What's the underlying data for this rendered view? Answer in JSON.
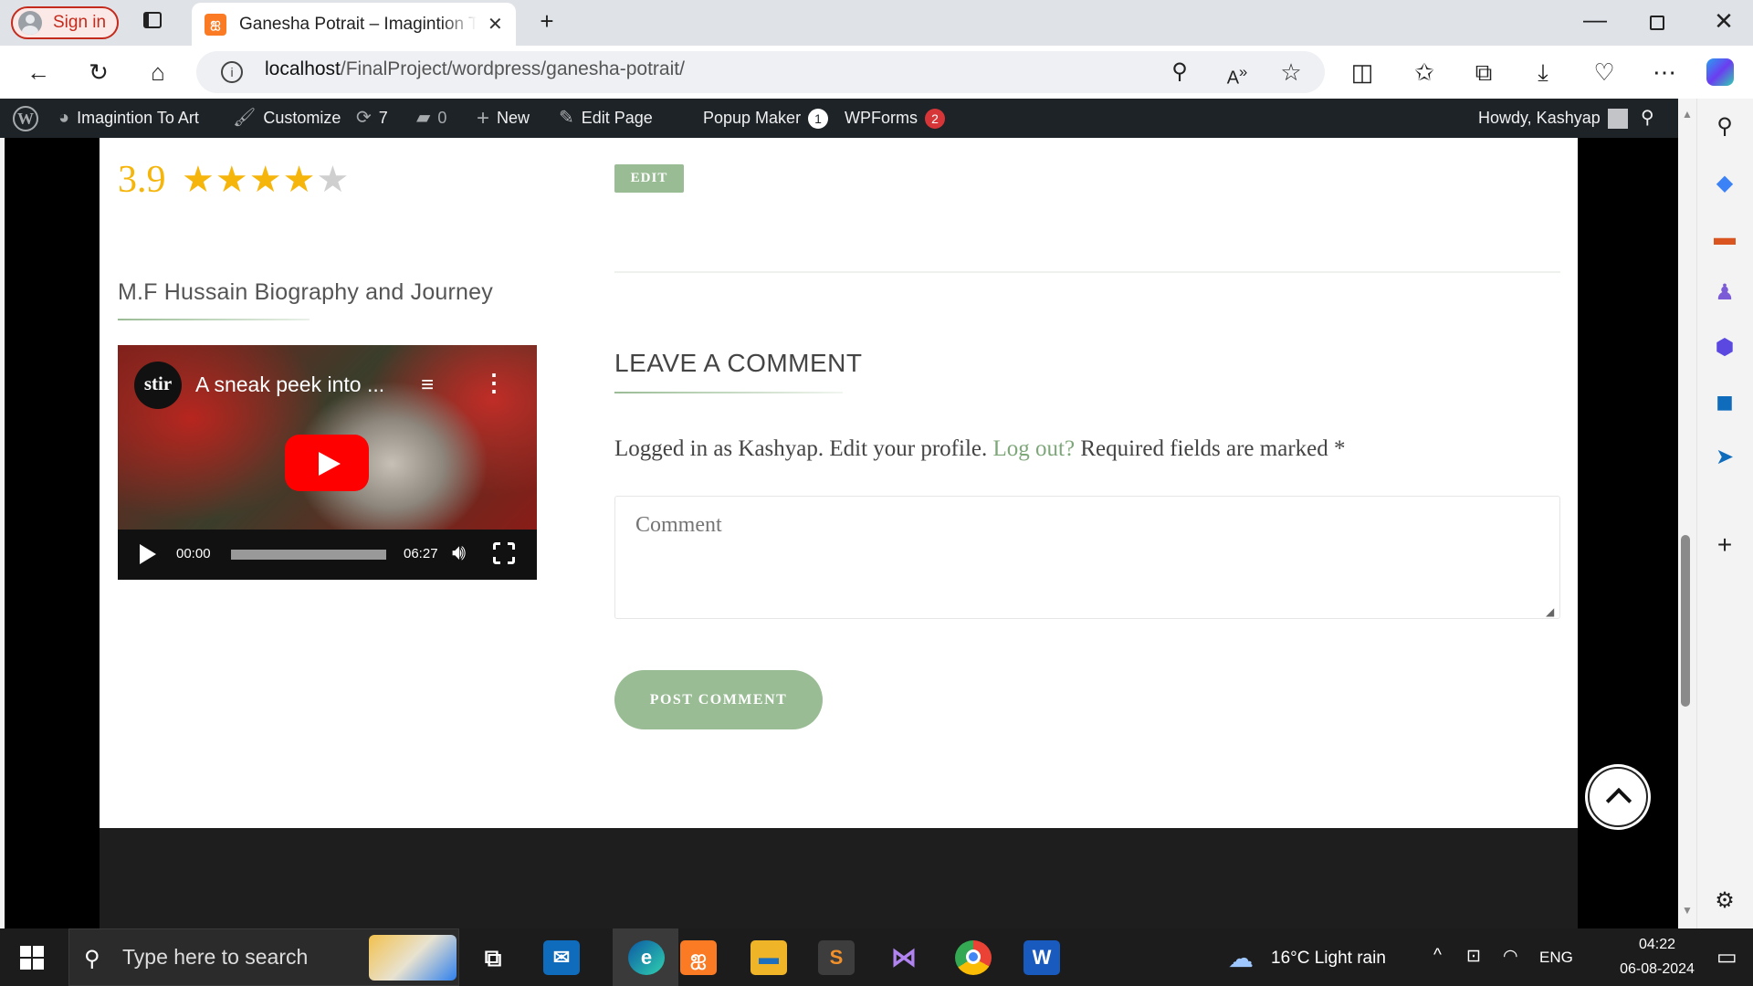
{
  "browser": {
    "signin_label": "Sign in",
    "tab_title": "Ganesha Potrait – Imagintion To Art",
    "url_host": "localhost",
    "url_path": "/FinalProject/wordpress/ganesha-potrait/"
  },
  "wp_admin_bar": {
    "site_name": "Imagintion To Art",
    "customize": "Customize",
    "updates_count": "7",
    "comments_count": "0",
    "new_label": "New",
    "edit_page": "Edit Page",
    "popup_maker": "Popup Maker",
    "popup_maker_count": "1",
    "wpforms": "WPForms",
    "wpforms_count": "2",
    "howdy": "Howdy, Kashyap"
  },
  "rating": {
    "value": "3.9",
    "stars_filled": 4,
    "stars_total": 5
  },
  "edit_button": "EDIT",
  "video_section": {
    "heading": "M.F Hussain Biography and Journey",
    "channel_logo": "stir",
    "video_title": "A sneak peek into ...",
    "current_time": "00:00",
    "duration": "06:27"
  },
  "comments": {
    "heading": "LEAVE A COMMENT",
    "logged_in_prefix": "Logged in as Kashyap. Edit your profile.",
    "logout_link": "Log out?",
    "required_note": "Required fields are marked *",
    "comment_placeholder": "Comment",
    "submit_label": "POST COMMENT"
  },
  "taskbar": {
    "search_placeholder": "Type here to search",
    "weather": "16°C  Light rain",
    "language": "ENG",
    "time": "04:22",
    "date": "06-08-2024"
  },
  "colors": {
    "accent_green": "#99bc94",
    "star_gold": "#f5b50b",
    "wp_bar": "#1d2327",
    "badge_red": "#d63638"
  }
}
